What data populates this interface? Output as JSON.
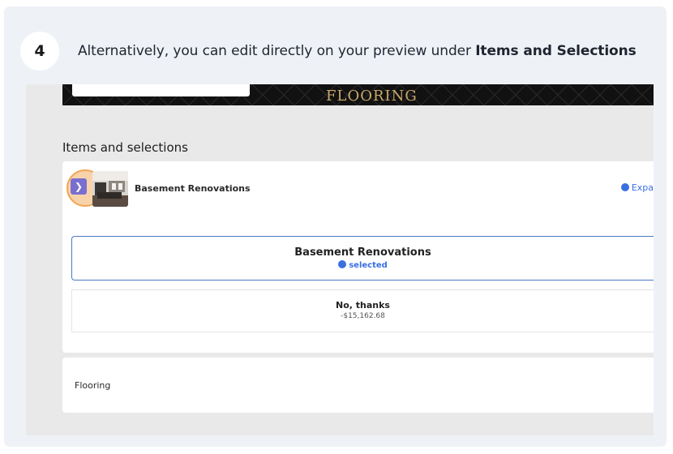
{
  "step": {
    "number": "4",
    "text_prefix": "Alternatively, you can edit directly on your preview under ",
    "text_bold": "Items and Selections"
  },
  "banner": {
    "word": "FLOORING"
  },
  "section": {
    "title": "Items and selections"
  },
  "item": {
    "name": "Basement Renovations",
    "expand_label": "Expa",
    "expand_icon": "chevron-right-icon"
  },
  "options": [
    {
      "title": "Basement Renovations",
      "status": "selected"
    },
    {
      "title": "No, thanks",
      "price": "-$15,162.68"
    }
  ],
  "next_item": {
    "name": "Flooring"
  },
  "colors": {
    "accent": "#3a6fe0",
    "expand_button": "#7a6fd0",
    "highlight": "#f2a65a",
    "selected_border": "#4a78c6"
  }
}
